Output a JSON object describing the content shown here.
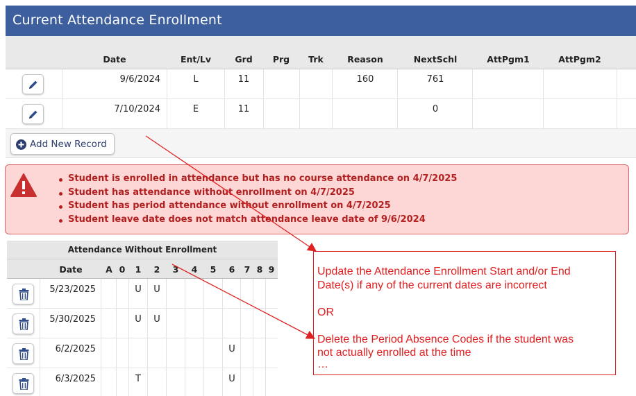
{
  "header": {
    "title": "Current Attendance Enrollment"
  },
  "enrollment": {
    "columns": [
      "Date",
      "Ent/Lv",
      "Grd",
      "Prg",
      "Trk",
      "Reason",
      "NextSchl",
      "AttPgm1",
      "AttPgm2"
    ],
    "rows": [
      {
        "date": "9/6/2024",
        "entlv": "L",
        "grd": "11",
        "prg": "",
        "trk": "",
        "reason": "160",
        "nextschl": "761",
        "attpgm1": "",
        "attpgm2": ""
      },
      {
        "date": "7/10/2024",
        "entlv": "E",
        "grd": "11",
        "prg": "",
        "trk": "",
        "reason": "",
        "nextschl": "0",
        "attpgm1": "",
        "attpgm2": ""
      }
    ],
    "add_label": "Add New Record"
  },
  "alert": {
    "messages": [
      "Student is enrolled in attendance but has no course attendance on 4/7/2025",
      "Student has attendance without enrollment on 4/7/2025",
      "Student has period attendance without enrollment on 4/7/2025",
      "Student leave date does not match attendance leave date of 9/6/2024"
    ],
    "color": "#b22020"
  },
  "awe": {
    "title": "Attendance Without Enrollment",
    "columns": [
      "Date",
      "A",
      "0",
      "1",
      "2",
      "3",
      "4",
      "5",
      "6",
      "7",
      "8",
      "9"
    ],
    "rows": [
      {
        "date": "5/23/2025",
        "p1": "U",
        "p2": "U",
        "p6": ""
      },
      {
        "date": "5/30/2025",
        "p1": "U",
        "p2": "U",
        "p6": ""
      },
      {
        "date": "6/2/2025",
        "p1": "",
        "p2": "",
        "p6": "U"
      },
      {
        "date": "6/3/2025",
        "p1": "T",
        "p2": "",
        "p6": "U"
      }
    ]
  },
  "callout": {
    "line1": "Update the Attendance Enrollment Start and/or End",
    "line2": "Date(s) if any of the current dates are incorrect",
    "or": "OR",
    "line3": "Delete the Period Absence Codes if the student was",
    "line4": "not actually enrolled at the time",
    "ellipsis": "…",
    "color": "#e02020"
  },
  "colors": {
    "header_bg": "#3d5f9e",
    "alert_bg": "#fdd6d6"
  }
}
